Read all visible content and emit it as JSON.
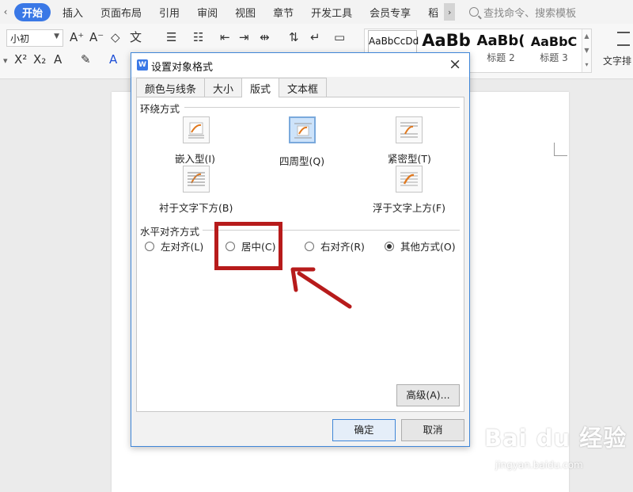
{
  "ribbon": {
    "tabs": [
      "开始",
      "插入",
      "页面布局",
      "引用",
      "审阅",
      "视图",
      "章节",
      "开发工具",
      "会员专享",
      "稻"
    ],
    "active_tab": "开始",
    "search_placeholder": "查找命令、搜索模板",
    "font_size_value": "小初",
    "styles": [
      {
        "preview": "AaBbCcDd",
        "name": ""
      },
      {
        "preview": "AaBb",
        "name": ""
      },
      {
        "preview": "AaBb(",
        "name": "标题 2"
      },
      {
        "preview": "AaBbC",
        "name": "标题 3"
      }
    ],
    "text_layout_label": "文字排"
  },
  "dialog": {
    "title": "设置对象格式",
    "tabs": [
      "颜色与线条",
      "大小",
      "版式",
      "文本框"
    ],
    "active_tab": "版式",
    "wrap_section_label": "环绕方式",
    "wrap_options": [
      {
        "label": "嵌入型(I)",
        "selected": false
      },
      {
        "label": "四周型(Q)",
        "selected": true
      },
      {
        "label": "紧密型(T)",
        "selected": false
      },
      {
        "label": "衬于文字下方(B)",
        "selected": false
      },
      {
        "label": "浮于文字上方(F)",
        "selected": false
      }
    ],
    "align_section_label": "水平对齐方式",
    "align_options": [
      {
        "label": "左对齐(L)",
        "checked": false
      },
      {
        "label": "居中(C)",
        "checked": false
      },
      {
        "label": "右对齐(R)",
        "checked": false
      },
      {
        "label": "其他方式(O)",
        "checked": true
      }
    ],
    "advanced_button": "高级(A)...",
    "ok_button": "确定",
    "cancel_button": "取消"
  },
  "annotation": {
    "color": "#b71b1b",
    "target": "居中(C)"
  },
  "watermark": {
    "logo": "Bai du 经验",
    "url": "jingyan.baidu.com"
  },
  "colors": {
    "accent": "#3a78e6",
    "dialog_border": "#3f86d8",
    "annotation": "#b71b1b"
  }
}
